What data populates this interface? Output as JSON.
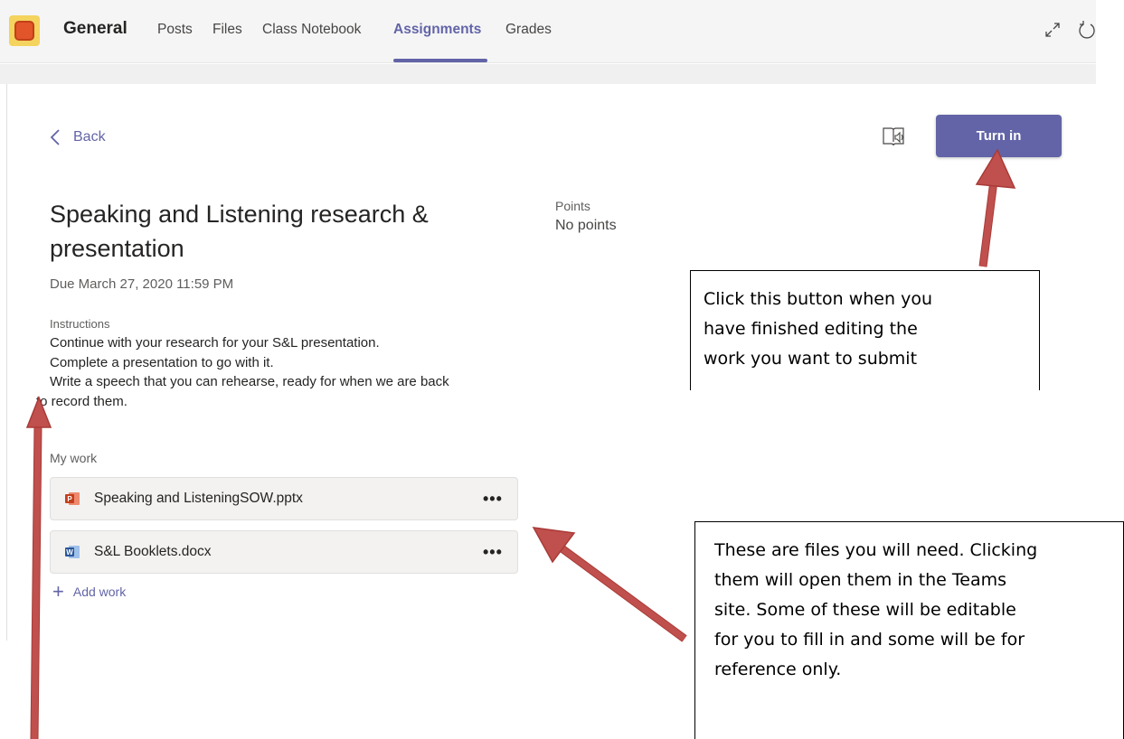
{
  "topbar": {
    "team_name": "General",
    "tabs": [
      {
        "label": "Posts"
      },
      {
        "label": "Files"
      },
      {
        "label": "Class Notebook"
      },
      {
        "label": "Assignments"
      },
      {
        "label": "Grades"
      }
    ],
    "active_tab": "Assignments"
  },
  "header": {
    "back_label": "Back",
    "turn_in_label": "Turn in"
  },
  "assignment": {
    "title": "Speaking and Listening research & presentation",
    "due": "Due March 27, 2020 11:59 PM",
    "points_label": "Points",
    "points_value": "No points",
    "instructions_label": "Instructions",
    "instructions": [
      "Continue with your research for your S&L presentation.",
      "Complete a presentation to go with it.",
      "Write a speech that you can rehearse, ready for when we are back",
      "to record them."
    ]
  },
  "my_work": {
    "label": "My work",
    "files": [
      {
        "name": "Speaking and ListeningSOW.pptx",
        "type": "pptx",
        "more": "•••"
      },
      {
        "name": "S&L Booklets.docx",
        "type": "docx",
        "more": "•••"
      }
    ],
    "add_work_label": "Add work"
  },
  "annotations": {
    "callout_turn_in": [
      "Click this button when you",
      "have finished editing the",
      "work you want to submit"
    ],
    "callout_files": [
      "These are files you will need. Clicking",
      "them will open them in the Teams",
      "site. Some of these will be editable",
      "for you to fill in and some will be for",
      "reference only."
    ]
  },
  "colors": {
    "accent": "#6264a7",
    "arrow": "#c0504d",
    "pptx": "#c43e1c",
    "docx": "#2b579a"
  },
  "icons": {
    "back": "chevron-left-icon",
    "reader": "immersive-reader-icon",
    "expand": "expand-icon",
    "refresh": "refresh-icon",
    "add": "plus-icon",
    "more": "more-options-icon"
  }
}
